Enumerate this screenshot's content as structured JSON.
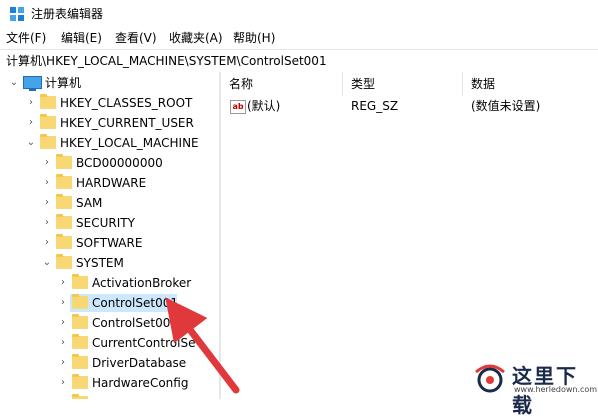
{
  "window": {
    "title": "注册表编辑器"
  },
  "menu": [
    "文件(F)",
    "编辑(E)",
    "查看(V)",
    "收藏夹(A)",
    "帮助(H)"
  ],
  "address": "计算机\\HKEY_LOCAL_MACHINE\\SYSTEM\\ControlSet001",
  "tree": {
    "root": "计算机",
    "hkcr": "HKEY_CLASSES_ROOT",
    "hkcu": "HKEY_CURRENT_USER",
    "hklm": "HKEY_LOCAL_MACHINE",
    "hklm_children": [
      "BCD00000000",
      "HARDWARE",
      "SAM",
      "SECURITY",
      "SOFTWARE",
      "SYSTEM"
    ],
    "system_children": [
      "ActivationBroker",
      "ControlSet001",
      "ControlSet002",
      "CurrentControlSe",
      "DriverDatabase",
      "HardwareConfig"
    ],
    "selected": "ControlSet001"
  },
  "list": {
    "headers": {
      "name": "名称",
      "type": "类型",
      "data": "数据"
    },
    "rows": [
      {
        "name": "(默认)",
        "type": "REG_SZ",
        "data": "(数值未设置)"
      }
    ]
  },
  "watermark": {
    "text": "这里下载",
    "url": "www.herledown.com"
  },
  "colors": {
    "selection": "#cce8ff",
    "folder": "#f8d775",
    "arrow": "#e0383b"
  }
}
